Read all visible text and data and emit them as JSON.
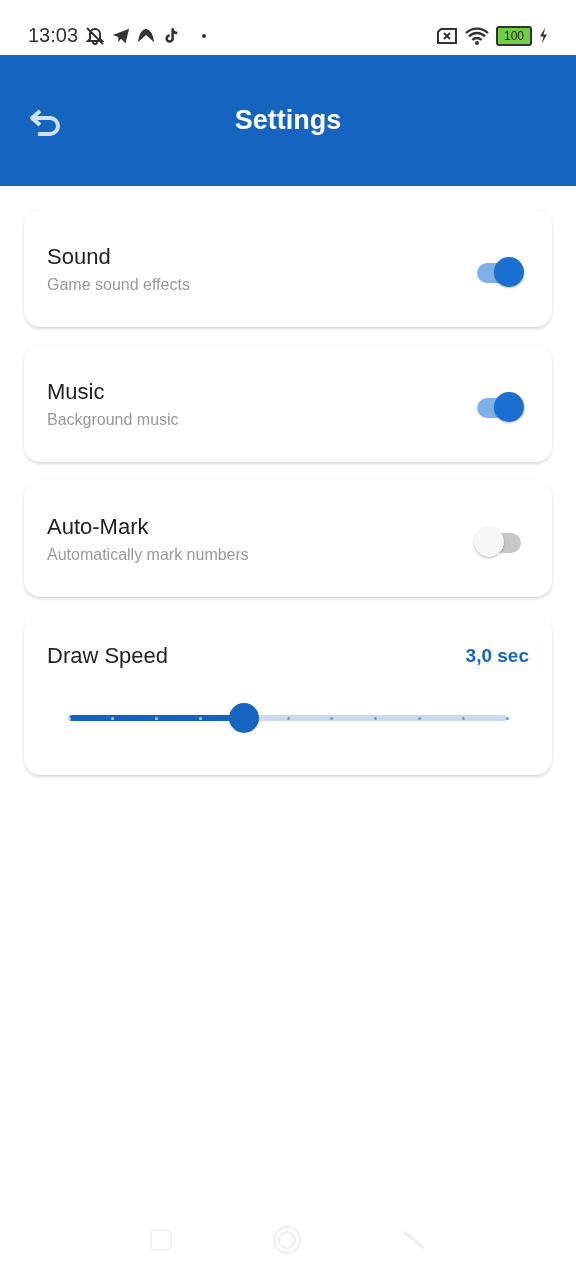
{
  "status_bar": {
    "time": "13:03",
    "battery": "100"
  },
  "app_bar": {
    "title": "Settings"
  },
  "settings": [
    {
      "kind": "toggle",
      "title": "Sound",
      "subtitle": "Game sound effects",
      "on": true
    },
    {
      "kind": "toggle",
      "title": "Music",
      "subtitle": "Background music",
      "on": true
    },
    {
      "kind": "toggle",
      "title": "Auto-Mark",
      "subtitle": "Automatically mark numbers",
      "on": false
    },
    {
      "kind": "slider",
      "title": "Draw Speed",
      "reading": "3,0 sec",
      "level": 0.4
    }
  ]
}
